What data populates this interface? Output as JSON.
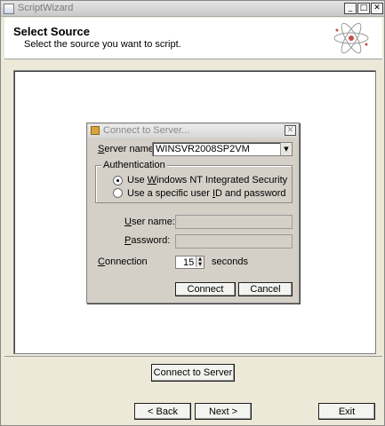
{
  "window": {
    "title": "ScriptWizard",
    "minimize_glyph": "_",
    "maximize_glyph": "□",
    "close_glyph": "✕"
  },
  "header": {
    "title": "Select Source",
    "subtitle": "Select the source you want to script."
  },
  "dialog": {
    "title": "Connect to Server...",
    "close_glyph": "✕",
    "server_label": "erver name:",
    "server_label_key": "S",
    "server_value": "WINSVR2008SP2VM",
    "dropdown_glyph": "▼",
    "auth_group_label": "Authentication",
    "radio_windows": {
      "pre": "Use ",
      "key": "W",
      "post": "indows NT Integrated Security",
      "selected": true
    },
    "radio_sql": {
      "pre": "Use a specific user ",
      "key": "I",
      "post": "D and password",
      "selected": false
    },
    "user_label_key": "U",
    "user_label": "ser name:",
    "password_label_key": "P",
    "password_label": "assword:",
    "user_value": "",
    "password_value": "",
    "connection_label_key": "C",
    "connection_label": "onnection",
    "timeout_value": "15",
    "seconds_label": "seconds",
    "connect_label": "Connect",
    "cancel_label": "Cancel"
  },
  "connect_to_server_label": "Connect to Server",
  "footer": {
    "back_label": "< Back",
    "next_label": "Next >",
    "exit_label": "Exit"
  },
  "icons": {
    "header": "atom-icon",
    "dialog": "server-icon"
  }
}
